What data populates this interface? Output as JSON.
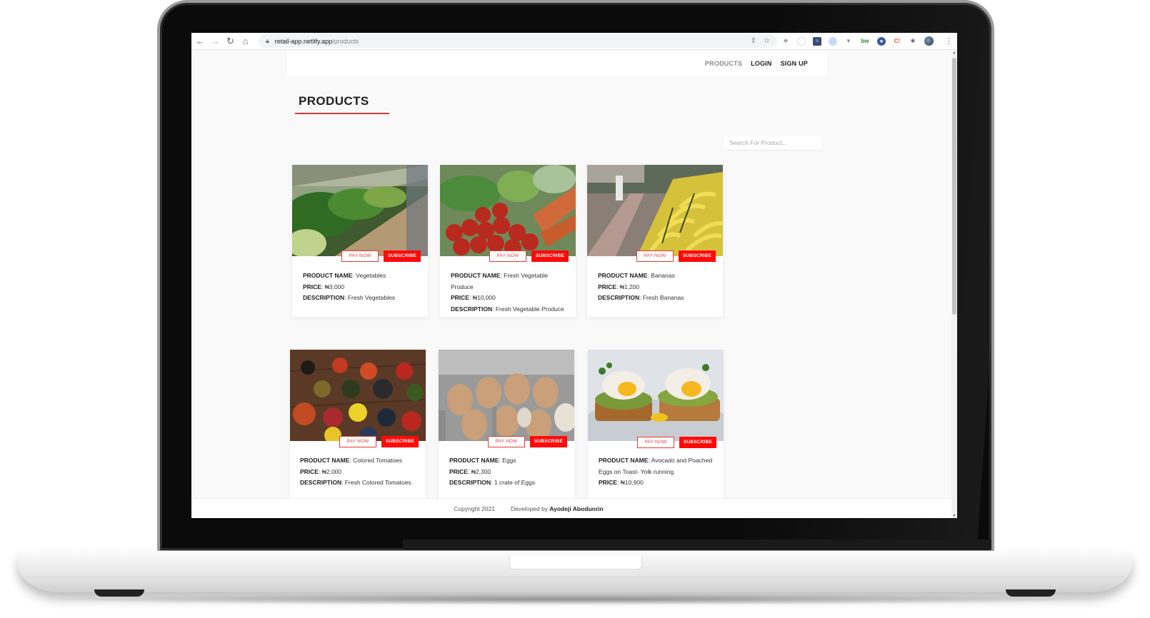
{
  "browser": {
    "url_host": "retail-app.netlify.app",
    "url_path": "/products",
    "nav_icons": [
      "back-icon",
      "forward-icon",
      "reload-icon",
      "home-icon"
    ],
    "omnibox_icons": [
      "share-icon",
      "bookmark-star-icon"
    ],
    "extensions": [
      "dropbox-extension-icon",
      "clock-extension-icon",
      "react-devtools-icon",
      "globe-extension-icon",
      "vue-devtools-icon",
      "bw-extension-icon",
      "blue-circle-extension-icon",
      "ci-extension-icon",
      "extensions-puzzle-icon"
    ]
  },
  "nav": {
    "links": [
      {
        "label": "PRODUCTS",
        "active": true
      },
      {
        "label": "LOGIN",
        "active": false
      },
      {
        "label": "SIGN UP",
        "active": false
      }
    ]
  },
  "page": {
    "title": "PRODUCTS",
    "search_placeholder": "Search For Product...",
    "accent_color": "#ff0a0a"
  },
  "labels": {
    "product_name": "PRODUCT NAME",
    "price": "PRICE",
    "description": "DESCRIPTION",
    "pay_now": "PAY NOW",
    "subscribe": "SUBSCRIBE"
  },
  "products": [
    {
      "name": "Vegetables",
      "price": "₦3,000",
      "description": "Fresh Vegetables"
    },
    {
      "name": "Fresh Vegetable Produce",
      "price": "₦10,000",
      "description": "Fresh Vegetable Produce"
    },
    {
      "name": "Bananas",
      "price": "₦1,200",
      "description": "Fresh Bananas"
    },
    {
      "name": "Colored Tomatoes",
      "price": "₦2,000",
      "description": "Fresh Colored Tomatoes"
    },
    {
      "name": "Eggs",
      "price": "₦2,300",
      "description": "1 crate of Eggs"
    },
    {
      "name": "Avocado and Poached Eggs on Toast- Yolk running",
      "price": "₦10,900",
      "description": ""
    }
  ],
  "footer": {
    "copyright": "Copyright 2021",
    "developed_by": "Developed by",
    "developer": "Ayodeji Abodunrin"
  }
}
